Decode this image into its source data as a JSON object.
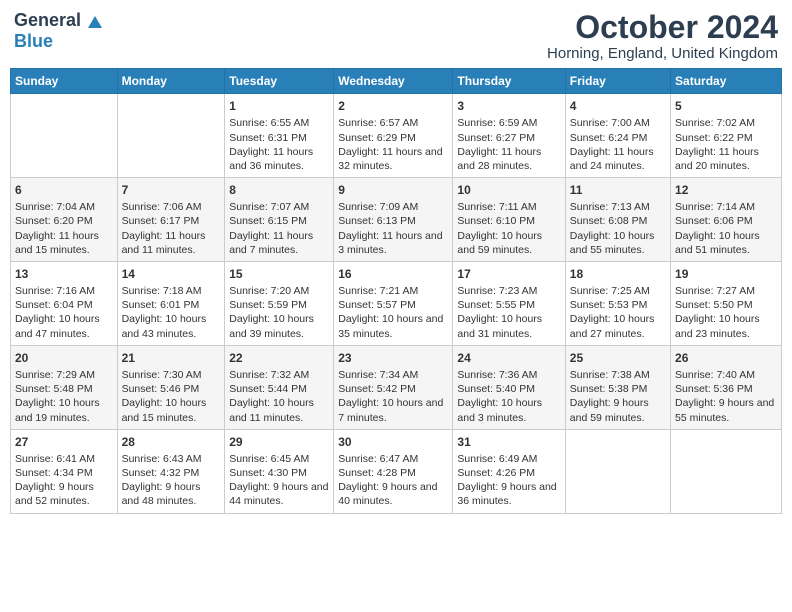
{
  "logo": {
    "general": "General",
    "blue": "Blue"
  },
  "title": "October 2024",
  "location": "Horning, England, United Kingdom",
  "days_of_week": [
    "Sunday",
    "Monday",
    "Tuesday",
    "Wednesday",
    "Thursday",
    "Friday",
    "Saturday"
  ],
  "weeks": [
    [
      {
        "day": "",
        "text": ""
      },
      {
        "day": "",
        "text": ""
      },
      {
        "day": "1",
        "text": "Sunrise: 6:55 AM\nSunset: 6:31 PM\nDaylight: 11 hours and 36 minutes."
      },
      {
        "day": "2",
        "text": "Sunrise: 6:57 AM\nSunset: 6:29 PM\nDaylight: 11 hours and 32 minutes."
      },
      {
        "day": "3",
        "text": "Sunrise: 6:59 AM\nSunset: 6:27 PM\nDaylight: 11 hours and 28 minutes."
      },
      {
        "day": "4",
        "text": "Sunrise: 7:00 AM\nSunset: 6:24 PM\nDaylight: 11 hours and 24 minutes."
      },
      {
        "day": "5",
        "text": "Sunrise: 7:02 AM\nSunset: 6:22 PM\nDaylight: 11 hours and 20 minutes."
      }
    ],
    [
      {
        "day": "6",
        "text": "Sunrise: 7:04 AM\nSunset: 6:20 PM\nDaylight: 11 hours and 15 minutes."
      },
      {
        "day": "7",
        "text": "Sunrise: 7:06 AM\nSunset: 6:17 PM\nDaylight: 11 hours and 11 minutes."
      },
      {
        "day": "8",
        "text": "Sunrise: 7:07 AM\nSunset: 6:15 PM\nDaylight: 11 hours and 7 minutes."
      },
      {
        "day": "9",
        "text": "Sunrise: 7:09 AM\nSunset: 6:13 PM\nDaylight: 11 hours and 3 minutes."
      },
      {
        "day": "10",
        "text": "Sunrise: 7:11 AM\nSunset: 6:10 PM\nDaylight: 10 hours and 59 minutes."
      },
      {
        "day": "11",
        "text": "Sunrise: 7:13 AM\nSunset: 6:08 PM\nDaylight: 10 hours and 55 minutes."
      },
      {
        "day": "12",
        "text": "Sunrise: 7:14 AM\nSunset: 6:06 PM\nDaylight: 10 hours and 51 minutes."
      }
    ],
    [
      {
        "day": "13",
        "text": "Sunrise: 7:16 AM\nSunset: 6:04 PM\nDaylight: 10 hours and 47 minutes."
      },
      {
        "day": "14",
        "text": "Sunrise: 7:18 AM\nSunset: 6:01 PM\nDaylight: 10 hours and 43 minutes."
      },
      {
        "day": "15",
        "text": "Sunrise: 7:20 AM\nSunset: 5:59 PM\nDaylight: 10 hours and 39 minutes."
      },
      {
        "day": "16",
        "text": "Sunrise: 7:21 AM\nSunset: 5:57 PM\nDaylight: 10 hours and 35 minutes."
      },
      {
        "day": "17",
        "text": "Sunrise: 7:23 AM\nSunset: 5:55 PM\nDaylight: 10 hours and 31 minutes."
      },
      {
        "day": "18",
        "text": "Sunrise: 7:25 AM\nSunset: 5:53 PM\nDaylight: 10 hours and 27 minutes."
      },
      {
        "day": "19",
        "text": "Sunrise: 7:27 AM\nSunset: 5:50 PM\nDaylight: 10 hours and 23 minutes."
      }
    ],
    [
      {
        "day": "20",
        "text": "Sunrise: 7:29 AM\nSunset: 5:48 PM\nDaylight: 10 hours and 19 minutes."
      },
      {
        "day": "21",
        "text": "Sunrise: 7:30 AM\nSunset: 5:46 PM\nDaylight: 10 hours and 15 minutes."
      },
      {
        "day": "22",
        "text": "Sunrise: 7:32 AM\nSunset: 5:44 PM\nDaylight: 10 hours and 11 minutes."
      },
      {
        "day": "23",
        "text": "Sunrise: 7:34 AM\nSunset: 5:42 PM\nDaylight: 10 hours and 7 minutes."
      },
      {
        "day": "24",
        "text": "Sunrise: 7:36 AM\nSunset: 5:40 PM\nDaylight: 10 hours and 3 minutes."
      },
      {
        "day": "25",
        "text": "Sunrise: 7:38 AM\nSunset: 5:38 PM\nDaylight: 9 hours and 59 minutes."
      },
      {
        "day": "26",
        "text": "Sunrise: 7:40 AM\nSunset: 5:36 PM\nDaylight: 9 hours and 55 minutes."
      }
    ],
    [
      {
        "day": "27",
        "text": "Sunrise: 6:41 AM\nSunset: 4:34 PM\nDaylight: 9 hours and 52 minutes."
      },
      {
        "day": "28",
        "text": "Sunrise: 6:43 AM\nSunset: 4:32 PM\nDaylight: 9 hours and 48 minutes."
      },
      {
        "day": "29",
        "text": "Sunrise: 6:45 AM\nSunset: 4:30 PM\nDaylight: 9 hours and 44 minutes."
      },
      {
        "day": "30",
        "text": "Sunrise: 6:47 AM\nSunset: 4:28 PM\nDaylight: 9 hours and 40 minutes."
      },
      {
        "day": "31",
        "text": "Sunrise: 6:49 AM\nSunset: 4:26 PM\nDaylight: 9 hours and 36 minutes."
      },
      {
        "day": "",
        "text": ""
      },
      {
        "day": "",
        "text": ""
      }
    ]
  ]
}
